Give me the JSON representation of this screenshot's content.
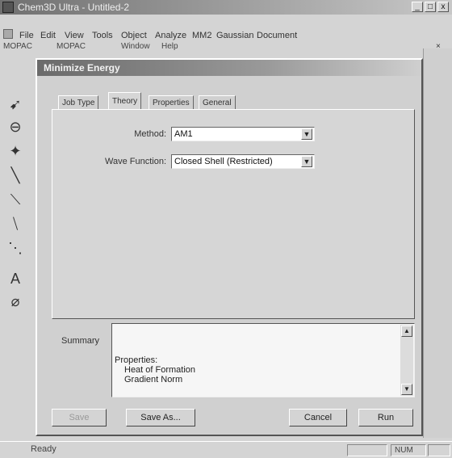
{
  "app": {
    "title": "Chem3D Ultra - Untitled-2",
    "window_buttons": {
      "minimize": "_",
      "maximize": "□",
      "close": "x"
    }
  },
  "menu": {
    "items": [
      "File",
      "Edit",
      "View",
      "Tools",
      "Object",
      "Analyze",
      "MM2",
      "Gaussian",
      "Document"
    ],
    "row2": [
      "MOPAC",
      "MOPAC",
      "Window",
      "Help"
    ]
  },
  "dialog": {
    "title": "Minimize Energy",
    "tabs": [
      "Job Type",
      "Theory",
      "Properties",
      "General"
    ],
    "active_tab": "Theory",
    "method_label": "Method:",
    "method_value": "AM1",
    "wave_function_label": "Wave Function:",
    "wave_function_value": "Closed Shell (Restricted)",
    "summary_label": "Summary",
    "summary_lines": [
      "Properties:",
      "Heat of Formation",
      "Gradient Norm"
    ],
    "buttons": {
      "save": "Save",
      "save_as": "Save As...",
      "cancel": "Cancel",
      "run": "Run"
    }
  },
  "status": {
    "left": "Ready",
    "num": "NUM"
  },
  "icons": [
    "select-arrow-icon",
    "rotate-icon",
    "move-icon",
    "single-bond-icon",
    "double-bond-icon",
    "triple-bond-icon",
    "dashed-bond-icon",
    "text-icon",
    "eraser-icon"
  ]
}
